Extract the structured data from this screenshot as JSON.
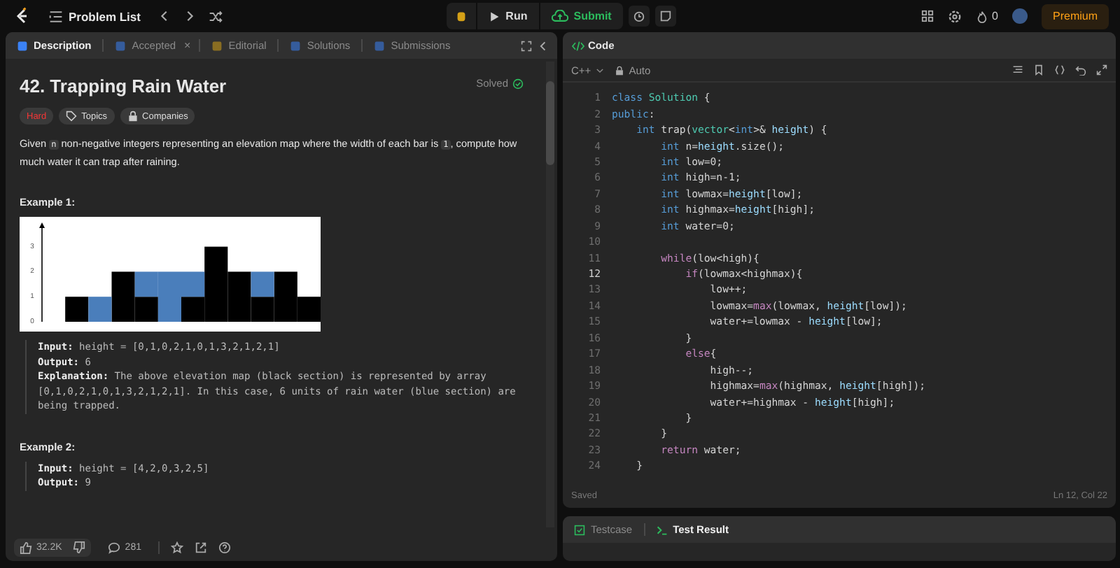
{
  "topbar": {
    "problem_list": "Problem List",
    "run": "Run",
    "submit": "Submit",
    "streak": "0",
    "premium": "Premium"
  },
  "left_tabs": [
    {
      "label": "Description",
      "selected": true
    },
    {
      "label": "Accepted",
      "selected": false,
      "close": "×"
    },
    {
      "label": "Editorial",
      "selected": false
    },
    {
      "label": "Solutions",
      "selected": false
    },
    {
      "label": "Submissions",
      "selected": false
    }
  ],
  "problem": {
    "title": "42. Trapping Rain Water",
    "status": "Solved",
    "difficulty": "Hard",
    "tags": [
      "Topics",
      "Companies"
    ],
    "statement": [
      {
        "kind": "text",
        "text": "Given "
      },
      {
        "kind": "code",
        "text": "n"
      },
      {
        "kind": "text",
        "text": " non-negative integers representing an elevation map where the width of each bar is "
      },
      {
        "kind": "code",
        "text": "1"
      },
      {
        "kind": "text",
        "text": ", compute how much water it can trap after raining."
      }
    ]
  },
  "examples": [
    {
      "title": "Example 1:",
      "figure": {
        "axis_labels": [
          "3",
          "2",
          "1",
          "0"
        ]
      },
      "lines": [
        {
          "label": "Input:",
          "value": "height = [0,1,0,2,1,0,1,3,2,1,2,1]"
        },
        {
          "label": "Output:",
          "value": "6"
        },
        {
          "label": "Explanation:",
          "value": "The above elevation map (black section) is represented by array [0,1,0,2,1,0,1,3,2,1,2,1]. In this case, 6 units of rain water (blue section) are being trapped."
        }
      ]
    },
    {
      "title": "Example 2:",
      "lines": [
        {
          "label": "Input:",
          "value": "height = [4,2,0,3,2,5]"
        },
        {
          "label": "Output:",
          "value": "9"
        }
      ]
    }
  ],
  "footer": {
    "likes": "32.2K",
    "comments": "281"
  },
  "code_panel": {
    "title": "Code",
    "language": "C++",
    "mode": "Auto",
    "status": "Saved",
    "cursor": "Ln 12, Col 22",
    "lines": [
      {
        "number": "1",
        "selected": false,
        "tokens": [
          {
            "kind": "keyword",
            "text": "class "
          },
          {
            "kind": "type",
            "text": "Solution"
          },
          {
            "kind": "plain",
            "text": " {"
          }
        ]
      },
      {
        "number": "2",
        "selected": false,
        "tokens": [
          {
            "kind": "keyword",
            "text": "public"
          },
          {
            "kind": "plain",
            "text": ":"
          }
        ]
      },
      {
        "number": "3",
        "selected": false,
        "tokens": [
          {
            "kind": "keyword",
            "text": "    int"
          },
          {
            "kind": "plain",
            "text": " trap("
          },
          {
            "kind": "type",
            "text": "vector"
          },
          {
            "kind": "plain",
            "text": "<"
          },
          {
            "kind": "keyword",
            "text": "int"
          },
          {
            "kind": "plain",
            "text": ">& "
          },
          {
            "kind": "variable",
            "text": "height"
          },
          {
            "kind": "plain",
            "text": ") {"
          }
        ]
      },
      {
        "number": "4",
        "selected": false,
        "tokens": [
          {
            "kind": "keyword",
            "text": "        int"
          },
          {
            "kind": "plain",
            "text": " n="
          },
          {
            "kind": "variable",
            "text": "height"
          },
          {
            "kind": "plain",
            "text": ".size();"
          }
        ]
      },
      {
        "number": "5",
        "selected": false,
        "tokens": [
          {
            "kind": "keyword",
            "text": "        int"
          },
          {
            "kind": "plain",
            "text": " low=0;"
          }
        ]
      },
      {
        "number": "6",
        "selected": false,
        "tokens": [
          {
            "kind": "keyword",
            "text": "        int"
          },
          {
            "kind": "plain",
            "text": " high=n-1;"
          }
        ]
      },
      {
        "number": "7",
        "selected": false,
        "tokens": [
          {
            "kind": "keyword",
            "text": "        int"
          },
          {
            "kind": "plain",
            "text": " lowmax="
          },
          {
            "kind": "variable",
            "text": "height"
          },
          {
            "kind": "plain",
            "text": "[low];"
          }
        ]
      },
      {
        "number": "8",
        "selected": false,
        "tokens": [
          {
            "kind": "keyword",
            "text": "        int"
          },
          {
            "kind": "plain",
            "text": " highmax="
          },
          {
            "kind": "variable",
            "text": "height"
          },
          {
            "kind": "plain",
            "text": "[high];"
          }
        ]
      },
      {
        "number": "9",
        "selected": false,
        "tokens": [
          {
            "kind": "keyword",
            "text": "        int"
          },
          {
            "kind": "plain",
            "text": " water=0;"
          }
        ]
      },
      {
        "number": "10",
        "selected": false
      },
      {
        "number": "11",
        "selected": false,
        "tokens": [
          {
            "kind": "control",
            "text": "        while"
          },
          {
            "kind": "plain",
            "text": "(low<high){"
          }
        ]
      },
      {
        "number": "12",
        "selected": true,
        "tokens": [
          {
            "kind": "control",
            "text": "            if"
          },
          {
            "kind": "plain",
            "text": "(lowmax<highmax){"
          }
        ]
      },
      {
        "number": "13",
        "selected": false,
        "tokens": [
          {
            "kind": "plain",
            "text": "                low++;"
          }
        ]
      },
      {
        "number": "14",
        "selected": false,
        "tokens": [
          {
            "kind": "plain",
            "text": "                lowmax="
          },
          {
            "kind": "control",
            "text": "max"
          },
          {
            "kind": "plain",
            "text": "(lowmax, "
          },
          {
            "kind": "variable",
            "text": "height"
          },
          {
            "kind": "plain",
            "text": "[low]);"
          }
        ]
      },
      {
        "number": "15",
        "selected": false,
        "tokens": [
          {
            "kind": "plain",
            "text": "                water+=lowmax - "
          },
          {
            "kind": "variable",
            "text": "height"
          },
          {
            "kind": "plain",
            "text": "[low];"
          }
        ]
      },
      {
        "number": "16",
        "selected": false,
        "tokens": [
          {
            "kind": "plain",
            "text": "            }"
          }
        ]
      },
      {
        "number": "17",
        "selected": false,
        "tokens": [
          {
            "kind": "control",
            "text": "            else"
          },
          {
            "kind": "plain",
            "text": "{"
          }
        ]
      },
      {
        "number": "18",
        "selected": false,
        "tokens": [
          {
            "kind": "plain",
            "text": "                high--;"
          }
        ]
      },
      {
        "number": "19",
        "selected": false,
        "tokens": [
          {
            "kind": "plain",
            "text": "                highmax="
          },
          {
            "kind": "control",
            "text": "max"
          },
          {
            "kind": "plain",
            "text": "(highmax, "
          },
          {
            "kind": "variable",
            "text": "height"
          },
          {
            "kind": "plain",
            "text": "[high]);"
          }
        ]
      },
      {
        "number": "20",
        "selected": false,
        "tokens": [
          {
            "kind": "plain",
            "text": "                water+=highmax - "
          },
          {
            "kind": "variable",
            "text": "height"
          },
          {
            "kind": "plain",
            "text": "[high];"
          }
        ]
      },
      {
        "number": "21",
        "selected": false,
        "tokens": [
          {
            "kind": "plain",
            "text": "            }"
          }
        ]
      },
      {
        "number": "22",
        "selected": false,
        "tokens": [
          {
            "kind": "plain",
            "text": "        }"
          }
        ]
      },
      {
        "number": "23",
        "selected": false,
        "tokens": [
          {
            "kind": "control",
            "text": "        return"
          },
          {
            "kind": "plain",
            "text": " water;"
          }
        ]
      },
      {
        "number": "24",
        "selected": false,
        "tokens": [
          {
            "kind": "plain",
            "text": "    }"
          }
        ]
      }
    ]
  },
  "bottom_tabs": [
    {
      "label": "Testcase",
      "selected": false
    },
    {
      "label": "Test Result",
      "selected": true
    }
  ]
}
